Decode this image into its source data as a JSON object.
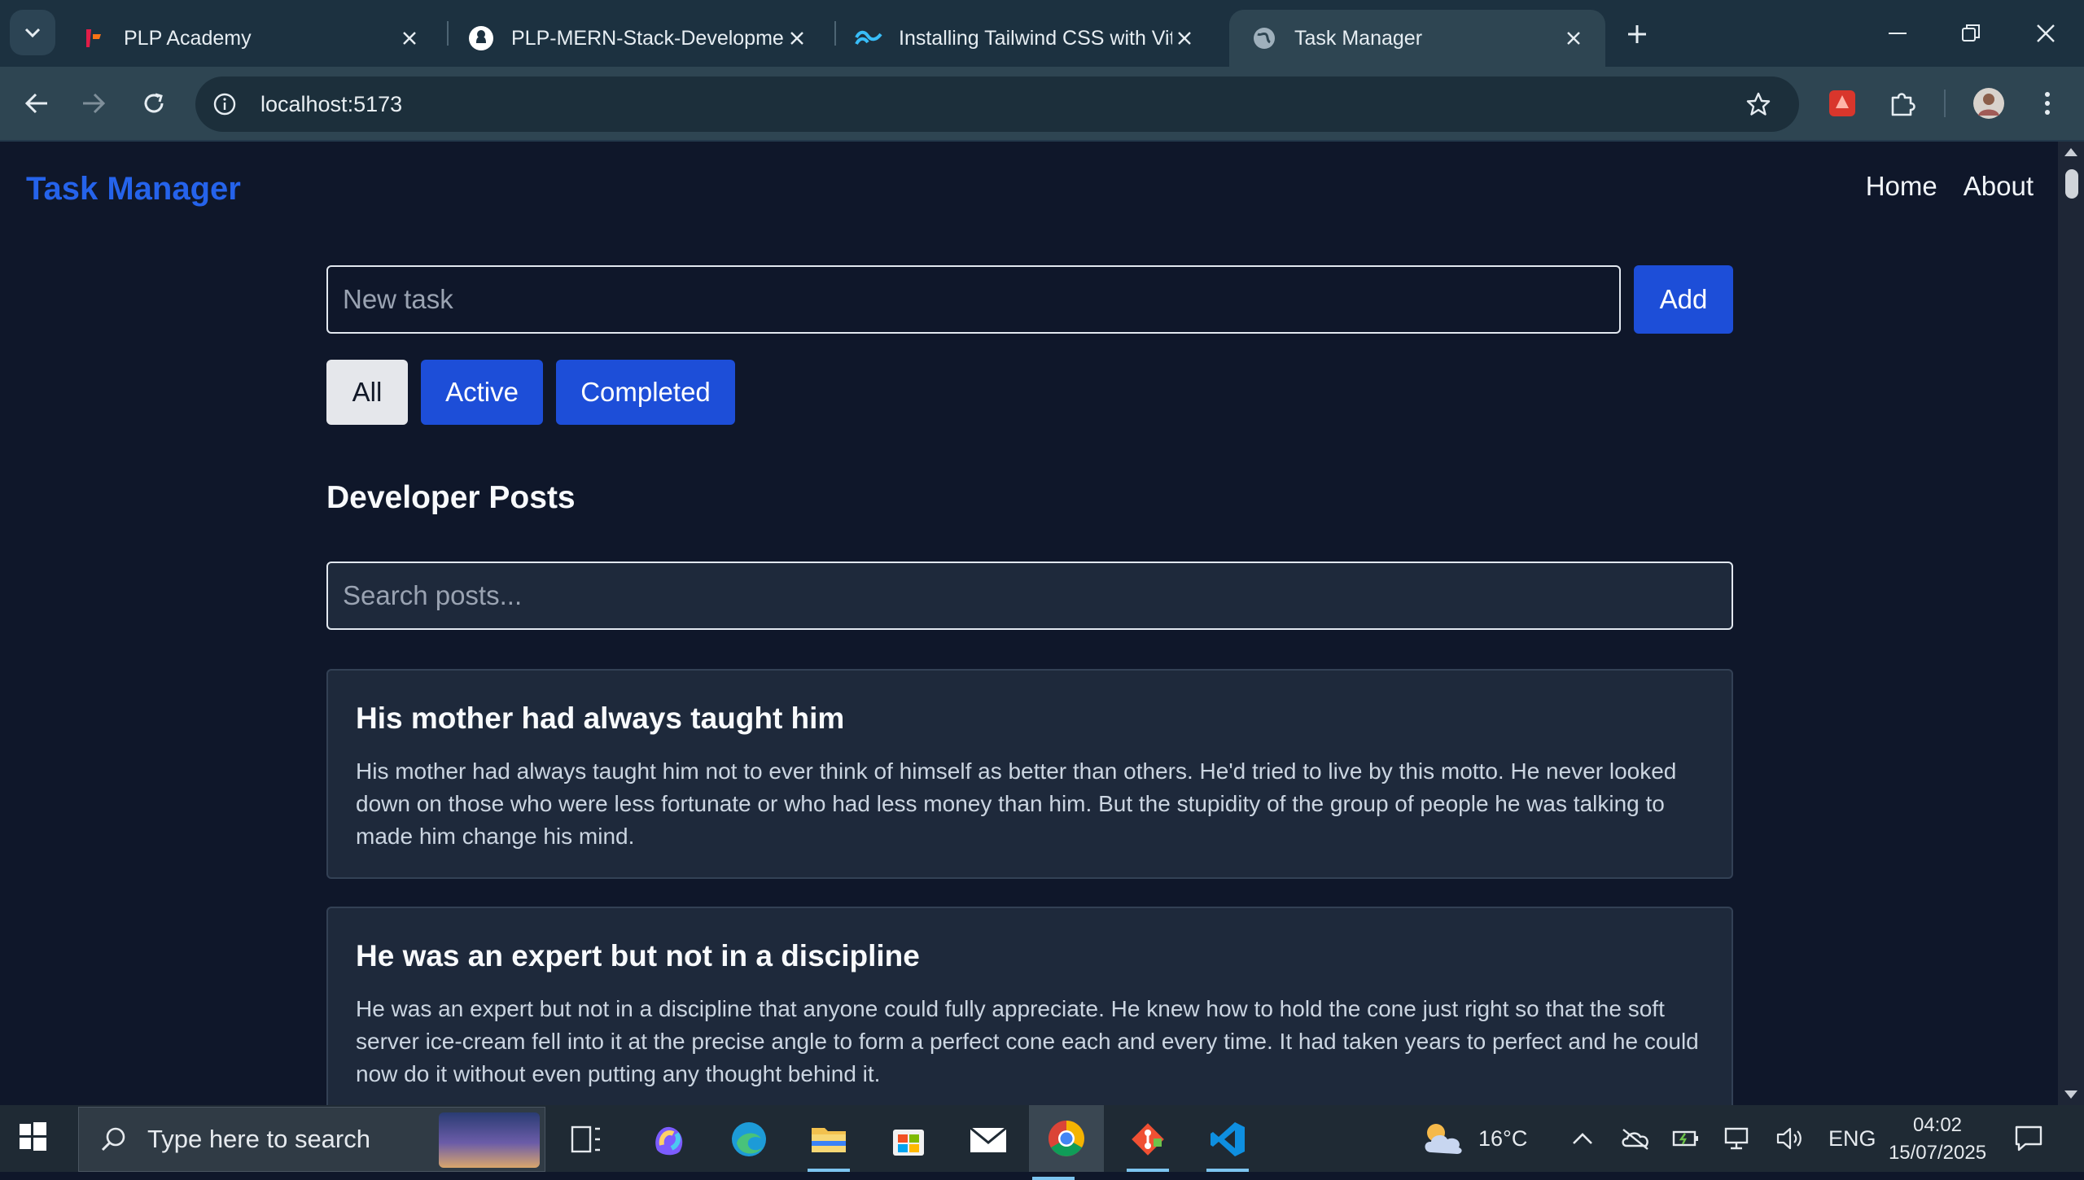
{
  "browser": {
    "tabs": [
      {
        "title": "PLP Academy",
        "icon": "plp-favicon"
      },
      {
        "title": "PLP-MERN-Stack-Development",
        "icon": "github-icon"
      },
      {
        "title": "Installing Tailwind CSS with Vite",
        "icon": "tailwind-icon"
      },
      {
        "title": "Task Manager",
        "icon": "globe-icon",
        "active": true
      }
    ],
    "url": "localhost:5173"
  },
  "app": {
    "brand": "Task Manager",
    "nav": {
      "home": "Home",
      "about": "About"
    },
    "new_task_placeholder": "New task",
    "add_label": "Add",
    "filters": {
      "all": "All",
      "active": "Active",
      "completed": "Completed"
    },
    "posts_heading": "Developer Posts",
    "search_placeholder": "Search posts...",
    "posts": [
      {
        "title": "His mother had always taught him",
        "body": "His mother had always taught him not to ever think of himself as better than others. He'd tried to live by this motto. He never looked down on those who were less fortunate or who had less money than him. But the stupidity of the group of people he was talking to made him change his mind."
      },
      {
        "title": "He was an expert but not in a discipline",
        "body": "He was an expert but not in a discipline that anyone could fully appreciate. He knew how to hold the cone just right so that the soft server ice-cream fell into it at the precise angle to form a perfect cone each and every time. It had taken years to perfect and he could now do it without even putting any thought behind it."
      }
    ]
  },
  "taskbar": {
    "search_placeholder": "Type here to search",
    "weather": "16°C",
    "language": "ENG",
    "time": "04:02",
    "date": "15/07/2025"
  },
  "colors": {
    "brand": "#2563eb",
    "button_blue": "#1d4ed8",
    "page_bg": "#0f172a",
    "card_bg": "#1e293b"
  }
}
